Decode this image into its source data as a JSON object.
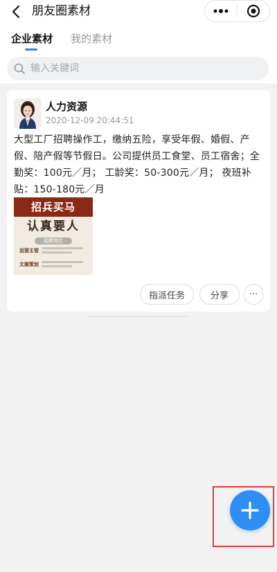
{
  "header": {
    "title": "朋友圈素材",
    "back_icon": "chevron-left-icon",
    "more_icon": "more-dots-icon",
    "close_icon": "target-circle-icon"
  },
  "tabs": [
    {
      "label": "企业素材",
      "active": true
    },
    {
      "label": "我的素材",
      "active": false
    }
  ],
  "search": {
    "placeholder": "输入关键词",
    "value": ""
  },
  "posts": [
    {
      "author": "人力资源",
      "time": "2020-12-09 20:44:51",
      "content": "大型工厂招聘操作工，缴纳五险，享受年假、婚假、产假、陪产假等节假日。公司提供员工食堂、员工宿舍；全勤奖：100元／月； 工龄奖：50-300元／月； 夜班补贴：150-180元／月",
      "image": {
        "headline": "招兵买马",
        "subheadline": "认真要人",
        "tag": "招聘岗位",
        "roles": [
          "运营主管",
          "文案策划"
        ]
      },
      "actions": {
        "assign_label": "指派任务",
        "share_label": "分享",
        "more_label": "···"
      }
    }
  ],
  "fab": {
    "icon": "plus-icon"
  },
  "colors": {
    "accent": "#2f7ef3",
    "fab": "#2f8ef5",
    "highlight_frame": "#e53935",
    "poster_header": "#8a2a16"
  }
}
